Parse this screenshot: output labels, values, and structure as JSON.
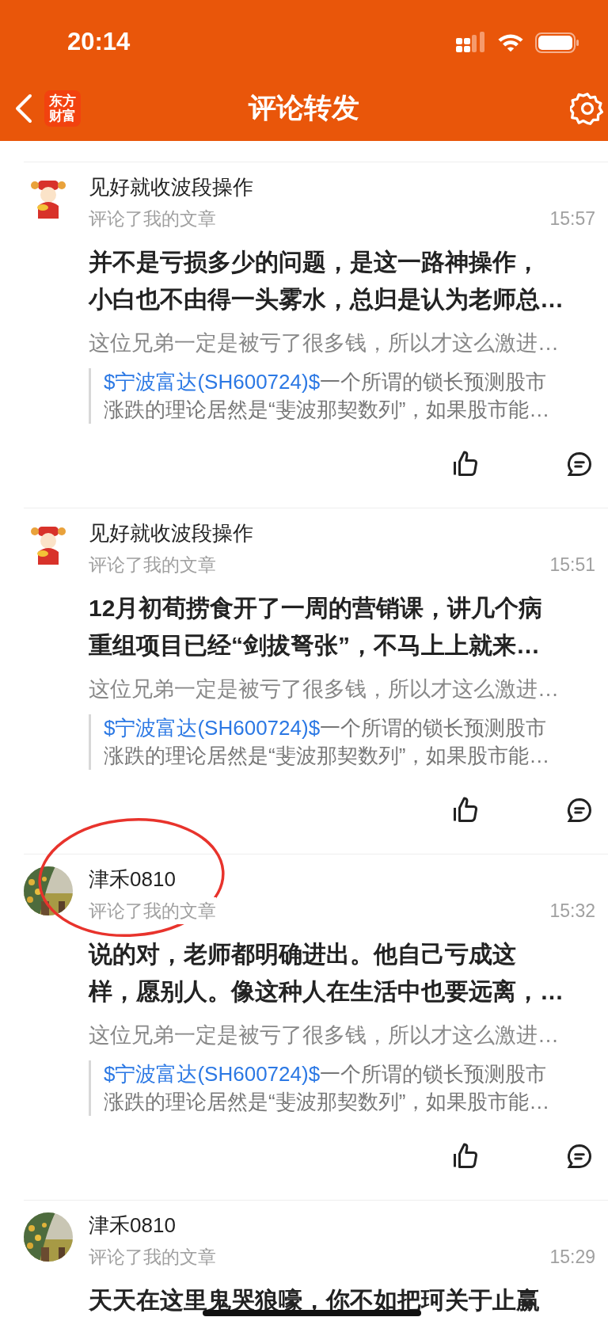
{
  "status_bar": {
    "time": "20:14"
  },
  "nav": {
    "logo_lines": [
      "东方",
      "财富"
    ],
    "title": "评论转发"
  },
  "comments": [
    {
      "avatar": {
        "kind": "mascot"
      },
      "user": "见好就收波段操作",
      "action": "评论了我的文章",
      "time": "15:57",
      "content_lines": [
        "并不是亏损多少的问题，是这一路神操作，",
        "小白也不由得一头雾水，总归是认为老师总…"
      ],
      "reply": "这位兄弟一定是被亏了很多钱，所以才这么激进…",
      "quote": {
        "link": "$宁波富达(SH600724)$",
        "lines": [
          "一个所谓的锁长预测股市",
          "涨跌的理论居然是“斐波那契数列”，如果股市能…"
        ]
      }
    },
    {
      "avatar": {
        "kind": "mascot"
      },
      "user": "见好就收波段操作",
      "action": "评论了我的文章",
      "time": "15:51",
      "content_lines": [
        "12月初荀捞食开了一周的营销课，讲几个病",
        "重组项目已经“剑拔弩张”，不马上上就来…"
      ],
      "reply": "这位兄弟一定是被亏了很多钱，所以才这么激进…",
      "quote": {
        "link": "$宁波富达(SH600724)$",
        "lines": [
          "一个所谓的锁长预测股市",
          "涨跌的理论居然是“斐波那契数列”，如果股市能…"
        ]
      }
    },
    {
      "avatar": {
        "kind": "picture"
      },
      "user": "津禾0810",
      "action": "评论了我的文章",
      "time": "15:32",
      "content_lines": [
        "说的对，老师都明确进出。他自己亏成这",
        "样，愿别人。像这种人在生活中也要远离，…"
      ],
      "reply": "这位兄弟一定是被亏了很多钱，所以才这么激进…",
      "quote": {
        "link": "$宁波富达(SH600724)$",
        "lines": [
          "一个所谓的锁长预测股市",
          "涨跌的理论居然是“斐波那契数列”，如果股市能…"
        ]
      }
    },
    {
      "avatar": {
        "kind": "picture"
      },
      "user": "津禾0810",
      "action": "评论了我的文章",
      "time": "15:29",
      "content_lines": [
        "天天在这里鬼哭狼嚎，你不如把珂关于止赢"
      ]
    }
  ]
}
